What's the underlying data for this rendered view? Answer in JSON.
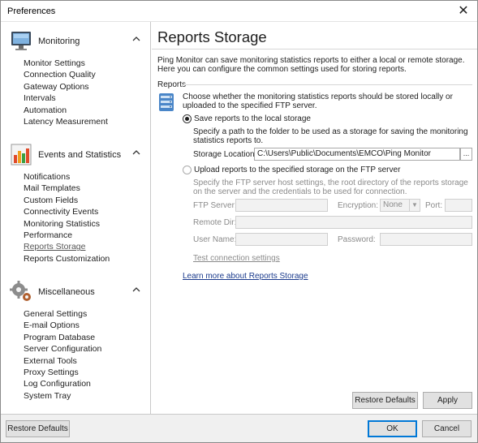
{
  "window": {
    "title": "Preferences",
    "close_glyph": "✕"
  },
  "sidebar": {
    "groups": [
      {
        "title": "Monitoring",
        "icon": "monitor-icon",
        "items": [
          "Monitor Settings",
          "Connection Quality",
          "Gateway Options",
          "Intervals",
          "Automation",
          "Latency Measurement"
        ]
      },
      {
        "title": "Events and Statistics",
        "icon": "statistics-chart-icon",
        "items": [
          "Notifications",
          "Mail Templates",
          "Custom Fields",
          "Connectivity Events",
          "Monitoring Statistics",
          "Performance",
          "Reports Storage",
          "Reports Customization"
        ]
      },
      {
        "title": "Miscellaneous",
        "icon": "gears-icon",
        "items": [
          "General Settings",
          "E-mail Options",
          "Program Database",
          "Server Configuration",
          "External Tools",
          "Proxy Settings",
          "Log Configuration",
          "System Tray"
        ]
      }
    ],
    "selected": "Reports Storage",
    "chevron_glyph": "⌃"
  },
  "page": {
    "title": "Reports Storage",
    "intro": "Ping Monitor can save monitoring statistics reports to either a local or remote storage. Here you can configure the common settings used for storing reports.",
    "section_label": "Reports",
    "section_desc": "Choose whether the monitoring statistics reports should be stored locally or uploaded to the specified FTP server.",
    "local": {
      "label": "Save reports to the local storage",
      "checked": true,
      "desc": "Specify a path to the folder to be used as a storage for saving the monitoring statistics reports to.",
      "location_label": "Storage Location:",
      "location_value": "C:\\Users\\Public\\Documents\\EMCO\\Ping Monitor",
      "browse_label": "..."
    },
    "ftp": {
      "label": "Upload reports to the specified storage on the FTP server",
      "checked": false,
      "desc": "Specify the FTP server host settings, the root directory of the reports storage on the server and the credentials to be used for connection.",
      "server_label": "FTP Server:",
      "server_value": "",
      "encryption_label": "Encryption:",
      "encryption_value": "None",
      "port_label": "Port:",
      "port_value": "",
      "remote_dir_label": "Remote Dir:",
      "remote_dir_value": "",
      "username_label": "User Name:",
      "username_value": "",
      "password_label": "Password:",
      "password_value": "",
      "test_link": "Test connection settings"
    },
    "learn_more_link": "Learn more about Reports Storage",
    "restore_defaults_label": "Restore Defaults",
    "apply_label": "Apply"
  },
  "footer": {
    "restore_defaults_label": "Restore Defaults",
    "ok_label": "OK",
    "cancel_label": "Cancel"
  },
  "colors": {
    "link": "#1a3a8c",
    "primary_border": "#0078d7",
    "disabled_text": "#8a8a8a"
  }
}
